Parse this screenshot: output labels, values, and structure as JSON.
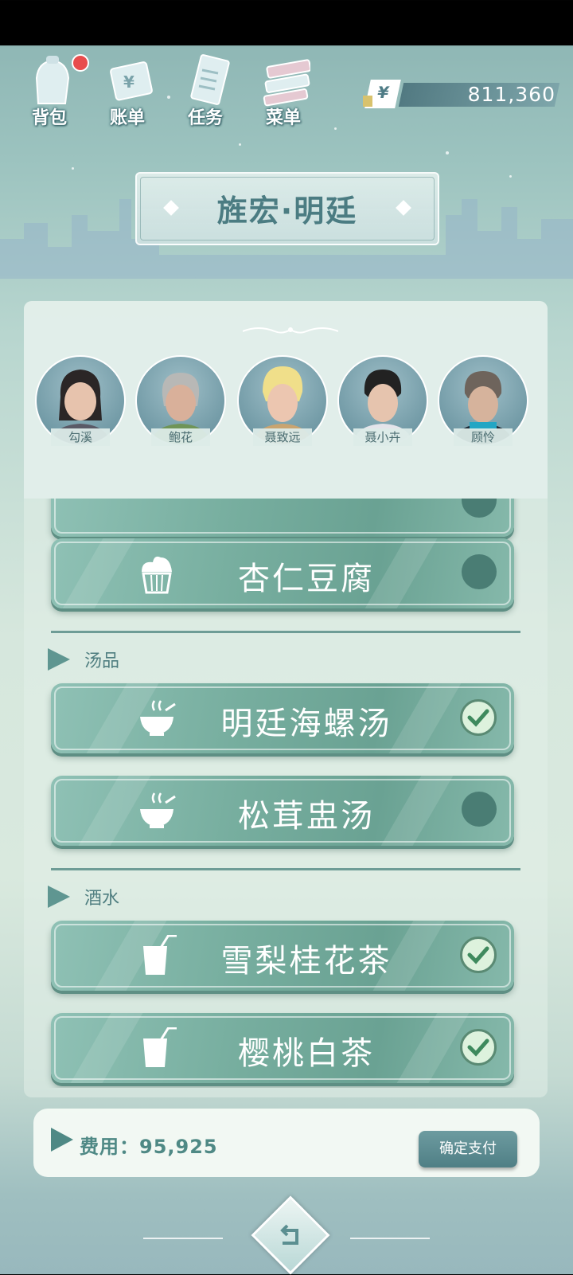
{
  "top_bar": {
    "buttons": [
      {
        "label": "背包",
        "icon": "backpack-icon",
        "has_badge": true
      },
      {
        "label": "账单",
        "icon": "bill-icon"
      },
      {
        "label": "任务",
        "icon": "task-icon"
      },
      {
        "label": "菜单",
        "icon": "menu-icon"
      }
    ],
    "currency_symbol": "¥",
    "money": "811,360"
  },
  "title": "旌宏·明廷",
  "guests": [
    {
      "name": "勾溪"
    },
    {
      "name": "鲍花"
    },
    {
      "name": "聂致远"
    },
    {
      "name": "聂小卉"
    },
    {
      "name": "顾怜"
    }
  ],
  "menu": {
    "dessert_items": [
      {
        "name": "杏仁豆腐",
        "icon": "cupcake-icon",
        "selected": false
      }
    ],
    "sections": [
      {
        "title": "汤品",
        "items": [
          {
            "name": "明廷海螺汤",
            "icon": "bowl-icon",
            "selected": true
          },
          {
            "name": "松茸盅汤",
            "icon": "bowl-icon",
            "selected": false
          }
        ]
      },
      {
        "title": "酒水",
        "items": [
          {
            "name": "雪梨桂花茶",
            "icon": "drink-cup-icon",
            "selected": true
          },
          {
            "name": "樱桃白茶",
            "icon": "drink-cup-icon",
            "selected": true
          }
        ]
      }
    ]
  },
  "footer": {
    "cost_label": "费用：95,925",
    "pay_button": "确定支付"
  },
  "colors": {
    "accent": "#4f8985",
    "item_bg": "#77ae9f",
    "check_on": "#ddf2dd",
    "badge": "#e84d4d"
  }
}
